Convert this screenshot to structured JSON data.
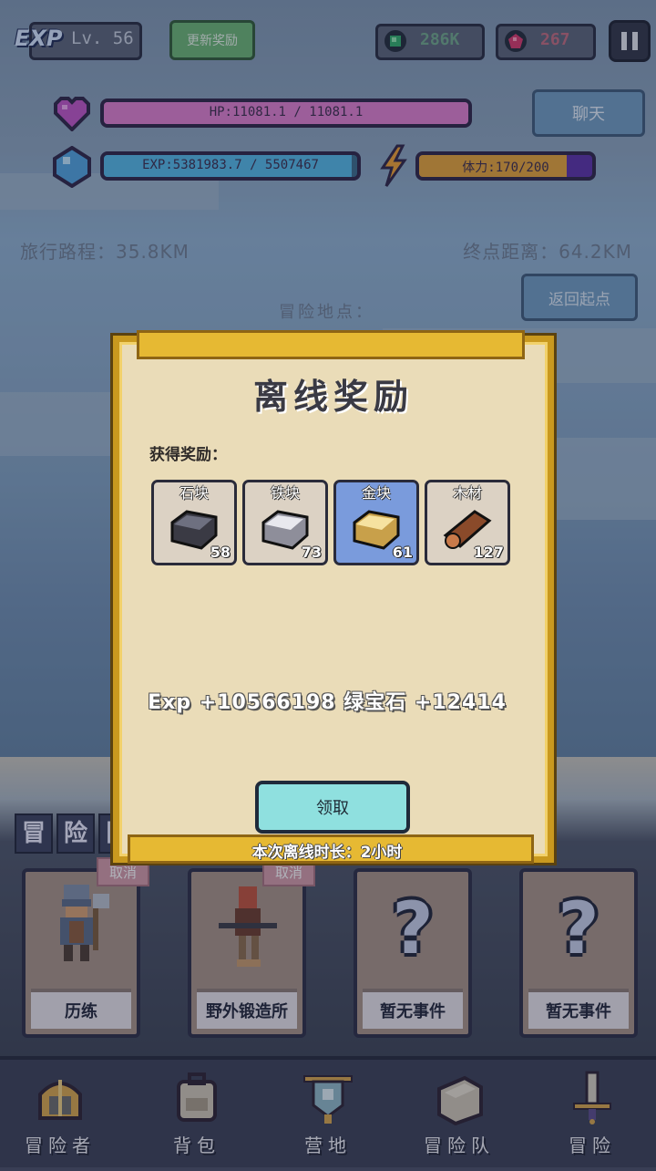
{
  "hud": {
    "exp_badge": "EXP",
    "level": "Lv. 56",
    "update_rewards": "更新奖励",
    "green_gems": "286K",
    "red_gems": "267",
    "hp": "HP:11081.1 / 11081.1",
    "exp": "EXP:5381983.7 / 5507467",
    "stamina": "体力:170/200",
    "hp_fraction": 1.0,
    "exp_fraction": 0.977,
    "stamina_fraction": 0.85,
    "chat": "聊天"
  },
  "travel": {
    "distance": "旅行路程：35.8KM",
    "remaining": "终点距离：64.2KM",
    "return_button": "返回起点",
    "location_label": "冒险地点："
  },
  "modal": {
    "title": "离线奖励",
    "rewards_label": "获得奖励：",
    "items": [
      {
        "name": "石块",
        "count": "58",
        "icon": "stone-block-icon"
      },
      {
        "name": "铁块",
        "count": "73",
        "icon": "iron-block-icon"
      },
      {
        "name": "金块",
        "count": "61",
        "icon": "gold-block-icon"
      },
      {
        "name": "木材",
        "count": "127",
        "icon": "wood-log-icon"
      }
    ],
    "exp_reward": "Exp +10566198  绿宝石 +12414",
    "claim_button": "领取",
    "offline_duration": "本次离线时长：2小时"
  },
  "adventure": {
    "heading_chars": [
      "冒",
      "险",
      "队"
    ],
    "cards": [
      {
        "label": "历练",
        "cancel": "取消",
        "icon": "warrior-icon"
      },
      {
        "label": "野外锻造所",
        "cancel": "取消",
        "icon": "blacksmith-icon"
      },
      {
        "label": "暂无事件",
        "icon": "question-mark-icon"
      },
      {
        "label": "暂无事件",
        "icon": "question-mark-icon"
      }
    ]
  },
  "nav": [
    {
      "label": "冒险者",
      "icon": "helmet-icon"
    },
    {
      "label": "背包",
      "icon": "backpack-icon"
    },
    {
      "label": "营地",
      "icon": "camp-banner-icon"
    },
    {
      "label": "冒险队",
      "icon": "book-icon"
    },
    {
      "label": "冒险",
      "icon": "sword-icon"
    }
  ],
  "colors": {
    "hp_fill": "#e07fd0",
    "exp_fill": "#52b8e8",
    "stamina_fill": "#e7a336",
    "modal_frame": "#c9991f",
    "claim_button": "#8fe0df"
  }
}
